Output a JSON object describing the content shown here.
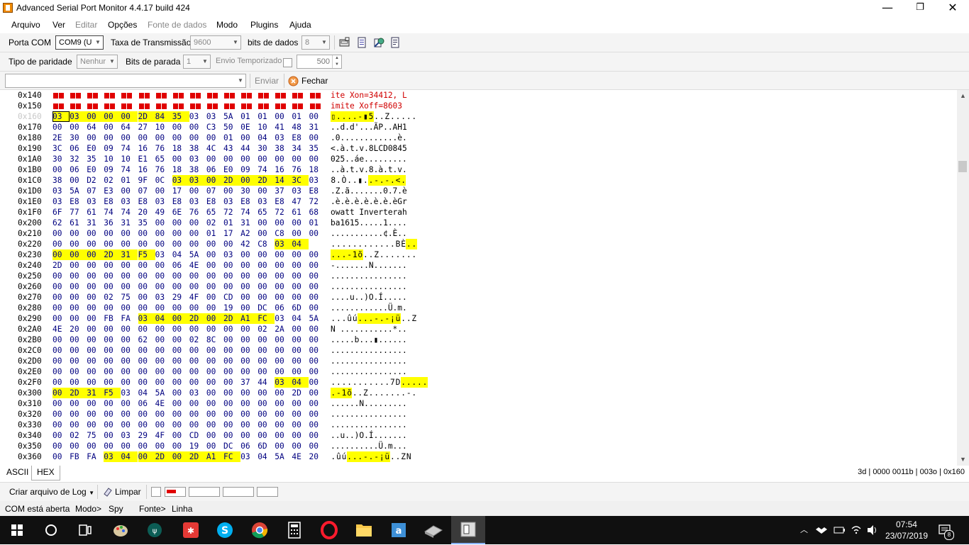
{
  "window": {
    "title": "Advanced Serial Port Monitor 4.4.17 build 424",
    "minimize": "—",
    "maximize": "❐",
    "close": "✕"
  },
  "menu": [
    "Arquivo",
    "Ver",
    "Editar",
    "Opções",
    "Fonte de dados",
    "Modo",
    "Plugins",
    "Ajuda"
  ],
  "menu_disabled": [
    "Editar",
    "Fonte de dados"
  ],
  "toolbar1": {
    "port_label": "Porta COM",
    "port_value": "COM9 (U",
    "baud_label": "Taxa de Transmissão",
    "baud_value": "9600",
    "bits_label": "bits de dados",
    "bits_value": "8"
  },
  "toolbar2": {
    "parity_label": "Tipo de paridade",
    "parity_value": "Nenhur",
    "stop_label": "Bits de parada",
    "stop_value": "1",
    "timed_label": "Envio Temporizado",
    "timed_value": "500"
  },
  "toolbar3": {
    "send_input": "",
    "send_label": "Enviar",
    "close_label": "Fechar"
  },
  "hex_rows": [
    {
      "offset": "0x140",
      "bytes": "R R R R R R R R R R R R R R R R",
      "ascii": "ite Xon=34412, L",
      "ascii_red": true
    },
    {
      "offset": "0x150",
      "bytes": "R R R R R R R R R R R R R R R R",
      "ascii": "imite Xoff=8603",
      "ascii_red": true
    },
    {
      "offset": "0x160",
      "bytes": "03 03 00 00 00 2D 84 35 03 03 5A 01 01 00 01 00",
      "ascii": "▯....-▮5..Z.....",
      "selected": true
    },
    {
      "offset": "0x170",
      "bytes": "00 00 64 00 64 27 10 00 00 C3 50 0E 10 41 48 31",
      "ascii": "..d.d'...ÃP..AH1"
    },
    {
      "offset": "0x180",
      "bytes": "2E 30 00 00 00 00 00 00 00 00 01 00 04 03 E8 00",
      "ascii": ".0............è."
    },
    {
      "offset": "0x190",
      "bytes": "3C 06 E0 09 74 16 76 18 38 4C 43 44 30 38 34 35",
      "ascii": "<.à.t.v.8LCD0845"
    },
    {
      "offset": "0x1A0",
      "bytes": "30 32 35 10 10 E1 65 00 03 00 00 00 00 00 00 00",
      "ascii": "025..áe........."
    },
    {
      "offset": "0x1B0",
      "bytes": "00 06 E0 09 74 16 76 18 38 06 E0 09 74 16 76 18",
      "ascii": "..à.t.v.8.à.t.v."
    },
    {
      "offset": "0x1C0",
      "bytes": "38 00 D2 02 01 9F 0C 03 03 00 2D 00 2D 14 3C 03",
      "ascii": "8.Ò..▮..-.-.<."
    },
    {
      "offset": "0x1D0",
      "bytes": "03 5A 07 E3 00 07 00 17 00 07 00 30 00 37 03 E8",
      "ascii": ".Z.ã.......0.7.è"
    },
    {
      "offset": "0x1E0",
      "bytes": "03 E8 03 E8 03 E8 03 E8 03 E8 03 E8 03 E8 47 72",
      "ascii": ".è.è.è.è.è.è.èGr"
    },
    {
      "offset": "0x1F0",
      "bytes": "6F 77 61 74 74 20 49 6E 76 65 72 74 65 72 61 68",
      "ascii": "owatt Inverterah"
    },
    {
      "offset": "0x200",
      "bytes": "62 61 31 36 31 35 00 00 00 02 01 31 00 00 00 01",
      "ascii": "ba1615.....1...."
    },
    {
      "offset": "0x210",
      "bytes": "00 00 00 00 00 00 00 00 00 01 17 A2 00 C8 00 00",
      "ascii": "...........¢.È.."
    },
    {
      "offset": "0x220",
      "bytes": "00 00 00 00 00 00 00 00 00 00 00 42 C8 03 04",
      "ascii": "............BÈ.."
    },
    {
      "offset": "0x230",
      "bytes": "00 00 00 2D 31 F5 03 04 5A 00 03 00 00 00 00 00",
      "ascii": "...-1õ..Z......."
    },
    {
      "offset": "0x240",
      "bytes": "2D 00 00 00 00 00 00 06 4E 00 00 00 00 00 00 00",
      "ascii": "-.......N......."
    },
    {
      "offset": "0x250",
      "bytes": "00 00 00 00 00 00 00 00 00 00 00 00 00 00 00 00",
      "ascii": "................"
    },
    {
      "offset": "0x260",
      "bytes": "00 00 00 00 00 00 00 00 00 00 00 00 00 00 00 00",
      "ascii": "................"
    },
    {
      "offset": "0x270",
      "bytes": "00 00 00 02 75 00 03 29 4F 00 CD 00 00 00 00 00",
      "ascii": "....u..)O.Í....."
    },
    {
      "offset": "0x280",
      "bytes": "00 00 00 00 00 00 00 00 00 00 19 00 DC 06 6D 00",
      "ascii": "............Ü.m."
    },
    {
      "offset": "0x290",
      "bytes": "00 00 00 FB FA 03 04 00 2D 00 2D A1 FC 03 04 5A",
      "ascii": "...ûú...-.-¡ü..Z"
    },
    {
      "offset": "0x2A0",
      "bytes": "4E 20 00 00 00 00 00 00 00 00 00 00 02 2A 00 00",
      "ascii": "N ...........*.."
    },
    {
      "offset": "0x2B0",
      "bytes": "00 00 00 00 00 62 00 00 02 8C 00 00 00 00 00 00",
      "ascii": ".....b...▮......"
    },
    {
      "offset": "0x2C0",
      "bytes": "00 00 00 00 00 00 00 00 00 00 00 00 00 00 00 00",
      "ascii": "................"
    },
    {
      "offset": "0x2D0",
      "bytes": "00 00 00 00 00 00 00 00 00 00 00 00 00 00 00 00",
      "ascii": "................"
    },
    {
      "offset": "0x2E0",
      "bytes": "00 00 00 00 00 00 00 00 00 00 00 00 00 00 00 00",
      "ascii": "................"
    },
    {
      "offset": "0x2F0",
      "bytes": "00 00 00 00 00 00 00 00 00 00 00 37 44 03 04 00 00",
      "ascii": "...........7D....."
    },
    {
      "offset": "0x300",
      "bytes": "00 2D 31 F5 03 04 5A 00 03 00 00 00 00 00 2D 00",
      "ascii": ".-1õ..Z.......-."
    },
    {
      "offset": "0x310",
      "bytes": "00 00 00 00 00 06 4E 00 00 00 00 00 00 00 00 00",
      "ascii": "......N........."
    },
    {
      "offset": "0x320",
      "bytes": "00 00 00 00 00 00 00 00 00 00 00 00 00 00 00 00",
      "ascii": "................"
    },
    {
      "offset": "0x330",
      "bytes": "00 00 00 00 00 00 00 00 00 00 00 00 00 00 00 00",
      "ascii": "................"
    },
    {
      "offset": "0x340",
      "bytes": "00 02 75 00 03 29 4F 00 CD 00 00 00 00 00 00 00",
      "ascii": "..u..)O.Í......."
    },
    {
      "offset": "0x350",
      "bytes": "00 00 00 00 00 00 00 00 19 00 DC 06 6D 00 00 00",
      "ascii": "..........Ü.m..."
    },
    {
      "offset": "0x360",
      "bytes": "00 FB FA 03 04 00 2D 00 2D A1 FC 03 04 5A 4E 20",
      "ascii": ".ûú...-.-¡ü..ZN"
    }
  ],
  "tabs": {
    "ascii": "ASCII",
    "hex": "HEX"
  },
  "status_right": "3d | 0000 0011b | 003o | 0x160",
  "logbar": {
    "create_log": "Criar arquivo de Log",
    "clear": "Limpar"
  },
  "statusbar": {
    "com": "COM está aberta",
    "mode": "Modo>",
    "mode_value": "Spy",
    "source": "Fonte>",
    "source_value": "Linha"
  },
  "taskbar": {
    "time": "07:54",
    "date": "23/07/2019",
    "notifications": "8"
  },
  "colors": {
    "highlight": "#ffff00",
    "hex_text": "#000080",
    "red_marker": "#e00000",
    "taskbar": "#101010"
  }
}
